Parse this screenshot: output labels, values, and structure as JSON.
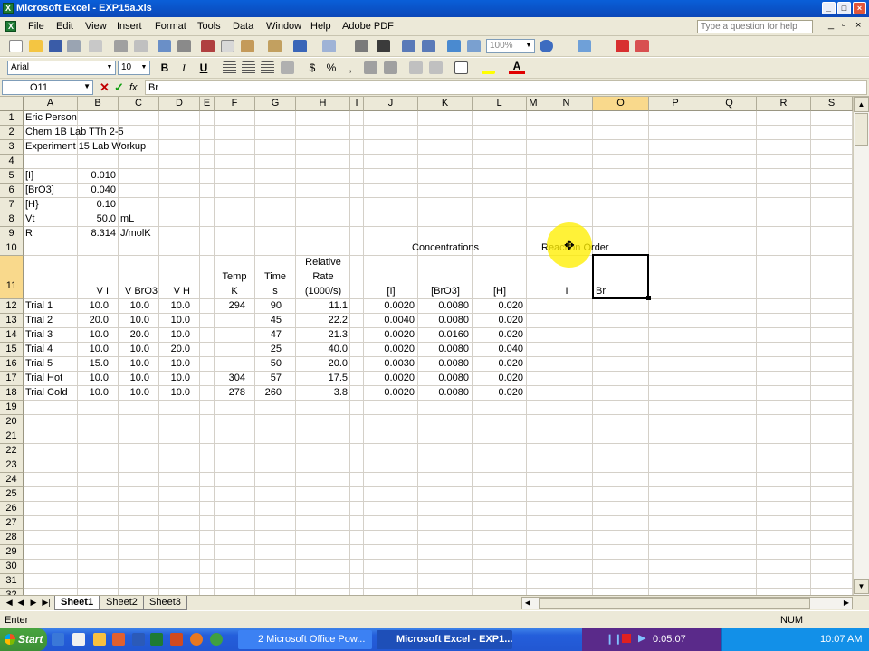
{
  "window": {
    "title": "Microsoft Excel - EXP15a.xls",
    "controls": [
      "_",
      "□",
      "×"
    ]
  },
  "menu": {
    "items": [
      "File",
      "Edit",
      "View",
      "Insert",
      "Format",
      "Tools",
      "Data",
      "Window",
      "Help",
      "Adobe PDF"
    ],
    "ask_placeholder": "Type a question for help",
    "doc_controls": [
      "_",
      "▫",
      "×"
    ]
  },
  "toolbar": {
    "zoom": "100%",
    "font": "Arial",
    "font_size": "10",
    "bold": "B",
    "italic": "I",
    "underline": "U",
    "currency": "$",
    "percent": "%",
    "comma": ",",
    "fontcolor": "A"
  },
  "formula": {
    "name_box": "O11",
    "cancel": "✕",
    "enter": "✓",
    "fx": "fx",
    "value": "Br"
  },
  "grid": {
    "columns": [
      "A",
      "B",
      "C",
      "D",
      "E",
      "F",
      "G",
      "H",
      "I",
      "J",
      "K",
      "L",
      "M",
      "N",
      "O",
      "P",
      "Q",
      "R",
      "S"
    ],
    "row_numbers": [
      "1",
      "2",
      "3",
      "4",
      "5",
      "6",
      "7",
      "8",
      "9",
      "10",
      "11",
      "12",
      "13",
      "14",
      "15",
      "16",
      "17",
      "18",
      "19",
      "20",
      "21",
      "22",
      "23",
      "24",
      "25",
      "26",
      "27",
      "28",
      "29",
      "30",
      "31",
      "32"
    ],
    "selected_column": "O",
    "selected_row": "11"
  },
  "sheet": {
    "header": {
      "name": "Eric Person",
      "course": "Chem 1B Lab TTh 2-5",
      "experiment": "Experiment 15 Lab Workup"
    },
    "params": [
      {
        "label": "[I]",
        "value": "0.010",
        "unit": ""
      },
      {
        "label": "[BrO3]",
        "value": "0.040",
        "unit": ""
      },
      {
        "label": "[H}",
        "value": "0.10",
        "unit": ""
      },
      {
        "label": "Vt",
        "value": "50.0",
        "unit": "mL"
      },
      {
        "label": "R",
        "value": "8.314",
        "unit": "J/molK"
      }
    ],
    "group_labels": {
      "concentrations": "Concentrations",
      "reaction_order": "Reaction Order"
    },
    "col_headers": {
      "vi": "V I",
      "vbro3": "V BrO3",
      "vh": "V H",
      "temp": "Temp",
      "temp_unit": "K",
      "time": "Time",
      "time_unit": "s",
      "rate_1": "Relative",
      "rate_2": "Rate",
      "rate_3": "(1000/s)",
      "conc_i": "[I]",
      "conc_bro3": "[BrO3]",
      "conc_h": "[H]",
      "order_i": "I",
      "order_br": "Br"
    },
    "trials": [
      {
        "name": "Trial 1",
        "vi": "10.0",
        "vbro3": "10.0",
        "vh": "10.0",
        "temp": "294",
        "time": "90",
        "rate": "11.1",
        "ci": "0.0020",
        "cbro3": "0.0080",
        "ch": "0.020"
      },
      {
        "name": "Trial 2",
        "vi": "20.0",
        "vbro3": "10.0",
        "vh": "10.0",
        "temp": "",
        "time": "45",
        "rate": "22.2",
        "ci": "0.0040",
        "cbro3": "0.0080",
        "ch": "0.020"
      },
      {
        "name": "Trial 3",
        "vi": "10.0",
        "vbro3": "20.0",
        "vh": "10.0",
        "temp": "",
        "time": "47",
        "rate": "21.3",
        "ci": "0.0020",
        "cbro3": "0.0160",
        "ch": "0.020"
      },
      {
        "name": "Trial 4",
        "vi": "10.0",
        "vbro3": "10.0",
        "vh": "20.0",
        "temp": "",
        "time": "25",
        "rate": "40.0",
        "ci": "0.0020",
        "cbro3": "0.0080",
        "ch": "0.040"
      },
      {
        "name": "Trial 5",
        "vi": "15.0",
        "vbro3": "10.0",
        "vh": "10.0",
        "temp": "",
        "time": "50",
        "rate": "20.0",
        "ci": "0.0030",
        "cbro3": "0.0080",
        "ch": "0.020"
      },
      {
        "name": "Trial Hot",
        "vi": "10.0",
        "vbro3": "10.0",
        "vh": "10.0",
        "temp": "304",
        "time": "57",
        "rate": "17.5",
        "ci": "0.0020",
        "cbro3": "0.0080",
        "ch": "0.020"
      },
      {
        "name": "Trial Cold",
        "vi": "10.0",
        "vbro3": "10.0",
        "vh": "10.0",
        "temp": "278",
        "time": "260",
        "rate": "3.8",
        "ci": "0.0020",
        "cbro3": "0.0080",
        "ch": "0.020"
      }
    ]
  },
  "tabs": {
    "sheets": [
      "Sheet1",
      "Sheet2",
      "Sheet3"
    ],
    "active": "Sheet1"
  },
  "status": {
    "mode": "Enter",
    "num": "NUM"
  },
  "taskbar": {
    "start": "Start",
    "items": [
      "2 Microsoft Office Pow...",
      "Microsoft Excel - EXP1..."
    ],
    "recorder_time": "0:05:07",
    "clock": "10:07 AM"
  },
  "colors": {
    "title_blue": "#0b47b8",
    "header_bg": "#ece9d8",
    "selected_header": "#f9d98c",
    "taskbar_blue": "#245edb",
    "start_green": "#3c8f35",
    "cursor_highlight": "#ffee00"
  },
  "icons": [
    "excel-icon",
    "new-icon",
    "open-icon",
    "save-icon",
    "print-icon",
    "spelling-icon",
    "cut-icon",
    "copy-icon",
    "paste-icon",
    "undo-icon",
    "redo-icon",
    "autosum-icon",
    "sort-icon",
    "chart-icon",
    "help-icon",
    "pdf-icon",
    "bold-icon",
    "align-left-icon",
    "borders-icon",
    "fill-color-icon",
    "font-color-icon"
  ]
}
